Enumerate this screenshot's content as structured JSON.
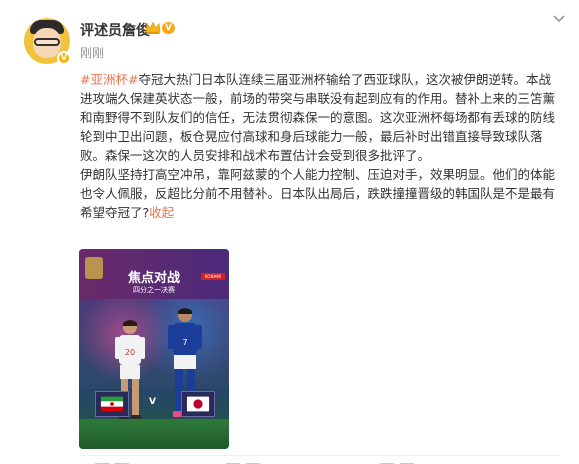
{
  "user": {
    "name": "评述员詹俊",
    "level_badge": "V",
    "timestamp": "刚刚"
  },
  "post": {
    "topic": "#亚洲杯#",
    "para1": "夺冠大热门日本队连续三届亚洲杯输给了西亚球队，这次被伊朗逆转。本战进攻端久保建英状态一般，前场的带突与串联没有起到应有的作用。替补上来的三笘薰和南野得不到队友们的信任，无法贯彻森保一的意图。这次亚洲杯每场都有丢球的防线轮到中卫出问题，板仓晃应付高球和身后球能力一般，最后补时出错直接导致球队落败。森保一这次的人员安排和战术布置估计会受到很多批评了。",
    "para2": "伊朗队坚持打高空冲吊，靠阿兹蒙的个人能力控制、压迫对手，效果明显。他们的体能也令人佩服，反超比分前不用替补。日本队出局后，跌跌撞撞晋级的韩国队是不是最有希望夺冠了?",
    "collapse_label": "收起"
  },
  "media": {
    "headline": "焦点对战",
    "subhead": "四分之一决赛",
    "sponsor": "KONAMI",
    "vs": "V",
    "player_white_number": "20",
    "player_blue_number": "7"
  },
  "colors": {
    "link": "#eb7350",
    "level_badge": "#f4a91a",
    "timestamp": "#939393"
  },
  "icons": [
    "avatar",
    "verified-badge-icon",
    "crown-icon",
    "chevron-down-icon",
    "iran-flag-icon",
    "japan-flag-icon"
  ]
}
